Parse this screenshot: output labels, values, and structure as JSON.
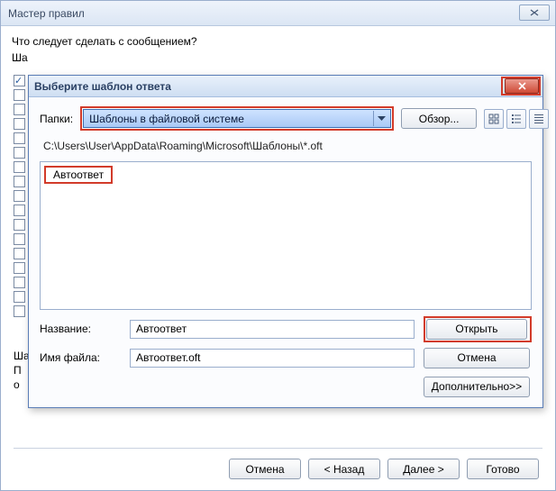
{
  "outer": {
    "title": "Мастер правил",
    "prompt": "Что следует сделать с сообщением?",
    "step1_label_short": "Ша",
    "step2_label_short": "Ша",
    "desc_line1": "П",
    "desc_line2": "о",
    "buttons": {
      "cancel": "Отмена",
      "back": "< Назад",
      "next": "Далее >",
      "finish": "Готово"
    }
  },
  "modal": {
    "title": "Выберите шаблон ответа",
    "folders_label": "Папки:",
    "folders_value": "Шаблоны в файловой системе",
    "browse": "Обзор...",
    "path": "C:\\Users\\User\\AppData\\Roaming\\Microsoft\\Шаблоны\\*.oft",
    "file_items": [
      "Автоответ"
    ],
    "name_label": "Название:",
    "name_value": "Автоответ",
    "filename_label": "Имя файла:",
    "filename_value": "Автоответ.oft",
    "open": "Открыть",
    "cancel": "Отмена",
    "advanced": "Дополнительно>>",
    "view_icons": [
      "large-icons",
      "list-view",
      "details-view"
    ]
  }
}
